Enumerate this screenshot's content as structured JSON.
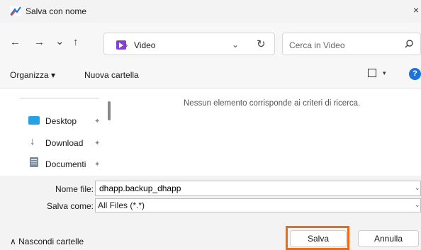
{
  "window": {
    "title": "Salva con nome",
    "close_glyph": "×"
  },
  "nav": {
    "back_glyph": "←",
    "forward_glyph": "→",
    "recent_glyph": "⌄",
    "up_glyph": "↑",
    "breadcrumb_separator": "›",
    "breadcrumb_label": "Video",
    "address_dropdown_glyph": "⌄",
    "refresh_glyph": "↻",
    "search_placeholder": "Cerca in Video"
  },
  "toolbar": {
    "organize_label": "Organizza ▾",
    "new_folder_label": "Nuova cartella",
    "view_caret": "▾",
    "help_label": "?"
  },
  "sidebar": {
    "items": [
      {
        "label": "Desktop",
        "icon": "desktop-icon",
        "pinned": true
      },
      {
        "label": "Download",
        "icon": "download-icon",
        "pinned": true
      },
      {
        "label": "Documenti",
        "icon": "documents-icon",
        "pinned": true
      }
    ],
    "pin_glyph": "✦"
  },
  "content": {
    "empty_message": "Nessun elemento corrisponde ai criteri di ricerca."
  },
  "form": {
    "name_label": "Nome file:",
    "name_value": "dhapp.backup_dhapp",
    "type_label": "Salva come:",
    "type_value": "All Files (*.*)",
    "dropdown_glyph": "⌄"
  },
  "footer": {
    "hide_folders_label": "∧ Nascondi cartelle",
    "save_label": "Salva",
    "cancel_label": "Annulla"
  },
  "colors": {
    "highlight": "#f26a0d",
    "accent": "#1f73d8",
    "video_folder": "#8b3dd9"
  }
}
